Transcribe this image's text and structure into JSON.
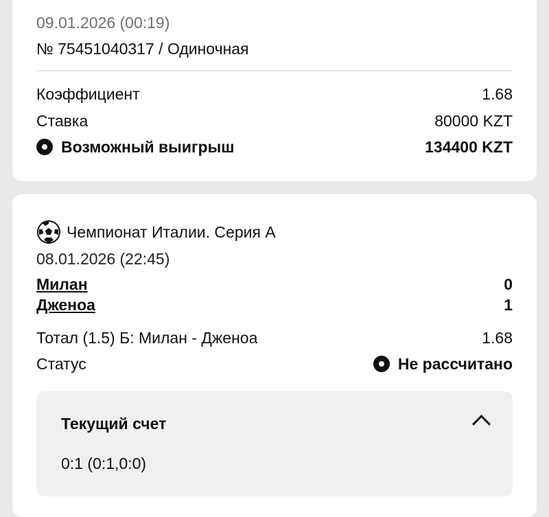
{
  "ticket": {
    "datetime": "09.01.2026 (00:19)",
    "number_line": "№ 75451040317 / Одиночная",
    "coefficient_label": "Коэффициент",
    "coefficient_value": "1.68",
    "stake_label": "Ставка",
    "stake_value": "80000 KZT",
    "win_label": "Возможный выигрыш",
    "win_value": "134400 KZT"
  },
  "event": {
    "league": "Чемпионат Италии. Серия А",
    "datetime": "08.01.2026 (22:45)",
    "home_team": "Милан",
    "home_score": "0",
    "away_team": "Дженоа",
    "away_score": "1",
    "market": "Тотал (1.5) Б: Милан - Дженоа",
    "market_odds": "1.68",
    "status_label": "Статус",
    "status_value": "Не рассчитано",
    "current_score_title": "Текущий счет",
    "current_score_value": "0:1 (0:1,0:0)"
  },
  "icons": {
    "league_icon": "soccer-ball-icon",
    "win_icon": "radio-dot-icon",
    "status_icon": "radio-dot-icon",
    "collapse_icon": "chevron-up-icon"
  }
}
